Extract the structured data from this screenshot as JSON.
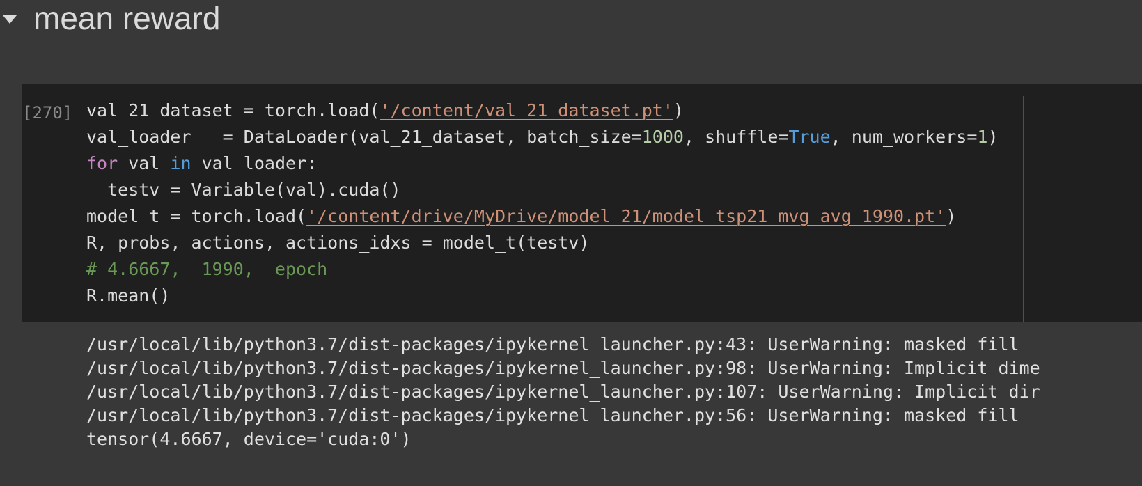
{
  "section": {
    "title": "mean reward",
    "toggle_icon": "triangle-down-icon"
  },
  "cell": {
    "exec_count": "[270]",
    "lines": [
      [
        {
          "t": "val_21_dataset = torch.load(",
          "c": ""
        },
        {
          "t": "'/content/val_21_dataset.pt'",
          "c": "str"
        },
        {
          "t": ")",
          "c": ""
        }
      ],
      [
        {
          "t": "val_loader   = DataLoader(val_21_dataset, batch_size=",
          "c": ""
        },
        {
          "t": "1000",
          "c": "num"
        },
        {
          "t": ", shuffle=",
          "c": ""
        },
        {
          "t": "True",
          "c": "bi"
        },
        {
          "t": ", num_workers=",
          "c": ""
        },
        {
          "t": "1",
          "c": "num"
        },
        {
          "t": ")",
          "c": ""
        }
      ],
      [
        {
          "t": "for",
          "c": "kw"
        },
        {
          "t": " val ",
          "c": ""
        },
        {
          "t": "in",
          "c": "bi"
        },
        {
          "t": " val_loader:",
          "c": ""
        }
      ],
      [
        {
          "t": "  testv = Variable(val).cuda()",
          "c": ""
        }
      ],
      [
        {
          "t": "model_t = torch.load(",
          "c": ""
        },
        {
          "t": "'/content/drive/MyDrive/model_21/model_tsp21_mvg_avg_1990.pt'",
          "c": "str"
        },
        {
          "t": ")",
          "c": ""
        }
      ],
      [
        {
          "t": "R, probs, actions, actions_idxs = model_t(testv)",
          "c": ""
        }
      ],
      [
        {
          "t": "# 4.6667,  1990,  epoch",
          "c": "cm"
        }
      ],
      [
        {
          "t": "R.mean()",
          "c": ""
        }
      ]
    ]
  },
  "output": {
    "lines": [
      "/usr/local/lib/python3.7/dist-packages/ipykernel_launcher.py:43: UserWarning: masked_fill_",
      "/usr/local/lib/python3.7/dist-packages/ipykernel_launcher.py:98: UserWarning: Implicit dime",
      "/usr/local/lib/python3.7/dist-packages/ipykernel_launcher.py:107: UserWarning: Implicit dir",
      "/usr/local/lib/python3.7/dist-packages/ipykernel_launcher.py:56: UserWarning: masked_fill_",
      "tensor(4.6667, device='cuda:0')"
    ]
  },
  "colors": {
    "page_bg": "#383838",
    "cell_bg": "#1f1f1f",
    "string": "#ce9178",
    "number": "#b5cea8",
    "keyword": "#c586c0",
    "builtin": "#569cd6",
    "comment": "#6a9955"
  }
}
